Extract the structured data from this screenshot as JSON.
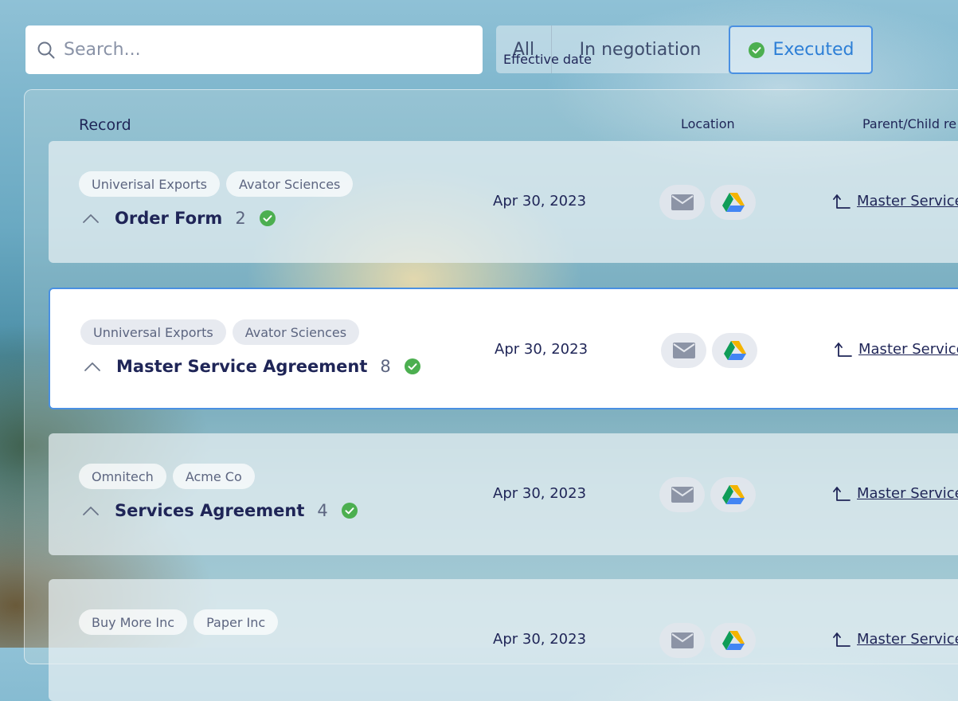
{
  "search": {
    "placeholder": "Search..."
  },
  "filters": [
    {
      "label": "All",
      "active": false
    },
    {
      "label": "In negotiation",
      "active": false
    },
    {
      "label": "Executed",
      "active": true
    }
  ],
  "table": {
    "columns": [
      "Record",
      "Effective date",
      "Location",
      "Parent/Child re"
    ],
    "rows": [
      {
        "tags": [
          "Univerisal Exports",
          "Avator Sciences"
        ],
        "title": "Order Form",
        "count": "2",
        "date": "Apr 30, 2023",
        "parent": "Master Service",
        "selected": false
      },
      {
        "tags": [
          "Unniversal Exports",
          "Avator Sciences"
        ],
        "title": "Master Service Agreement",
        "count": "8",
        "date": "Apr 30, 2023",
        "parent": "Master Service",
        "selected": true
      },
      {
        "tags": [
          "Omnitech",
          "Acme Co"
        ],
        "title": "Services Agreement",
        "count": "4",
        "date": "Apr 30, 2023",
        "parent": "Master Service",
        "selected": false
      },
      {
        "tags": [
          "Buy More Inc",
          "Paper Inc"
        ],
        "title": "",
        "count": "",
        "date": "Apr 30, 2023",
        "parent": "Master Service",
        "selected": false
      }
    ]
  },
  "colors": {
    "accent": "#4a90e2",
    "success": "#4caf50",
    "text": "#1f2557"
  },
  "icons": {
    "search": "search-icon",
    "check": "check-circle-icon",
    "mail": "mail-icon",
    "drive": "google-drive-icon",
    "chevron": "chevron-up-icon",
    "parent": "parent-arrow-icon"
  }
}
